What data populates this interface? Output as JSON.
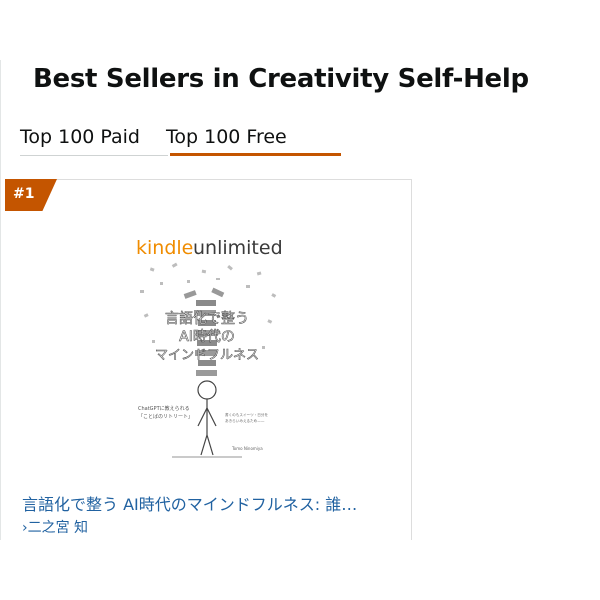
{
  "page": {
    "title": "Best Sellers in Creativity Self-Help"
  },
  "tabs": [
    {
      "label": "Top 100 Paid"
    },
    {
      "label": "Top 100 Free",
      "active": true
    }
  ],
  "item": {
    "rank": "#1",
    "cover": {
      "brand_kindle": "kindle",
      "brand_unlimited": "unlimited",
      "title_line1": "言語化で整う",
      "title_line2": "AI時代の",
      "title_line3": "マインドフルネス",
      "subtitle_left_1": "ChatGPTに教えられる",
      "subtitle_left_2": "「ことばのリトリート」",
      "subtitle_right_1": "書くのもスイーツ・日分を",
      "subtitle_right_2": "あきらいみえるため——",
      "author_small": "Tomo Ninomiya"
    },
    "title": "言語化で整う AI時代のマインドフルネス: 誰…",
    "author": "›二之宮 知"
  },
  "colors": {
    "accent": "#c45500",
    "link": "#2162a1"
  }
}
